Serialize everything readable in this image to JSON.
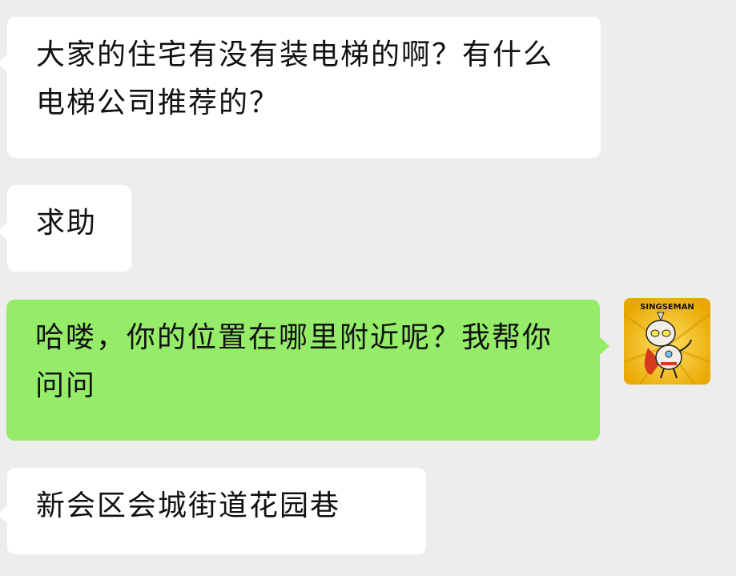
{
  "messages": [
    {
      "sender": "other",
      "text": "大家的住宅有没有装电梯的啊？有什么电梯公司推荐的？"
    },
    {
      "sender": "other",
      "text": "求助"
    },
    {
      "sender": "self",
      "text": "哈喽，你的位置在哪里附近呢？我帮你问问"
    },
    {
      "sender": "other",
      "text": "新会区会城街道花园巷"
    }
  ],
  "avatar": {
    "label": "SINGSEMAN",
    "icon": "cartoon-hero-icon"
  },
  "colors": {
    "background": "#ededed",
    "incoming_bubble": "#ffffff",
    "outgoing_bubble": "#95ec69",
    "avatar_bg": "#f3c012"
  }
}
